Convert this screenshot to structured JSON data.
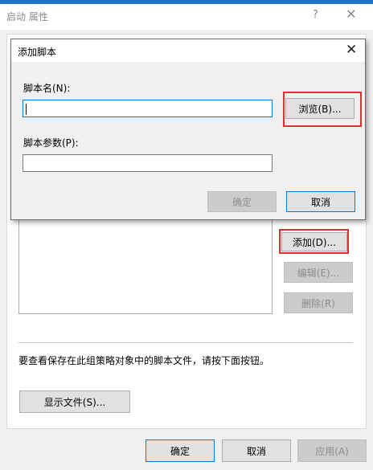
{
  "window": {
    "title": "启动 属性",
    "help_glyph": "?",
    "close_glyph": "✕"
  },
  "main_buttons": {
    "add": "添加(D)...",
    "edit": "编辑(E)...",
    "remove": "删除(R)"
  },
  "info_text": "要查看保存在此组策略对象中的脚本文件，请按下面按钮。",
  "show_files": "显示文件(S)...",
  "footer": {
    "ok": "确定",
    "cancel": "取消",
    "apply": "应用(A)"
  },
  "dialog": {
    "title": "添加脚本",
    "close_glyph": "✕",
    "script_name_label": "脚本名(N):",
    "script_name_value": "",
    "browse": "浏览(B)...",
    "script_params_label": "脚本参数(P):",
    "script_params_value": "",
    "ok": "确定",
    "cancel": "取消"
  },
  "colors": {
    "accent": "#0078d7",
    "highlight": "#e03030"
  }
}
